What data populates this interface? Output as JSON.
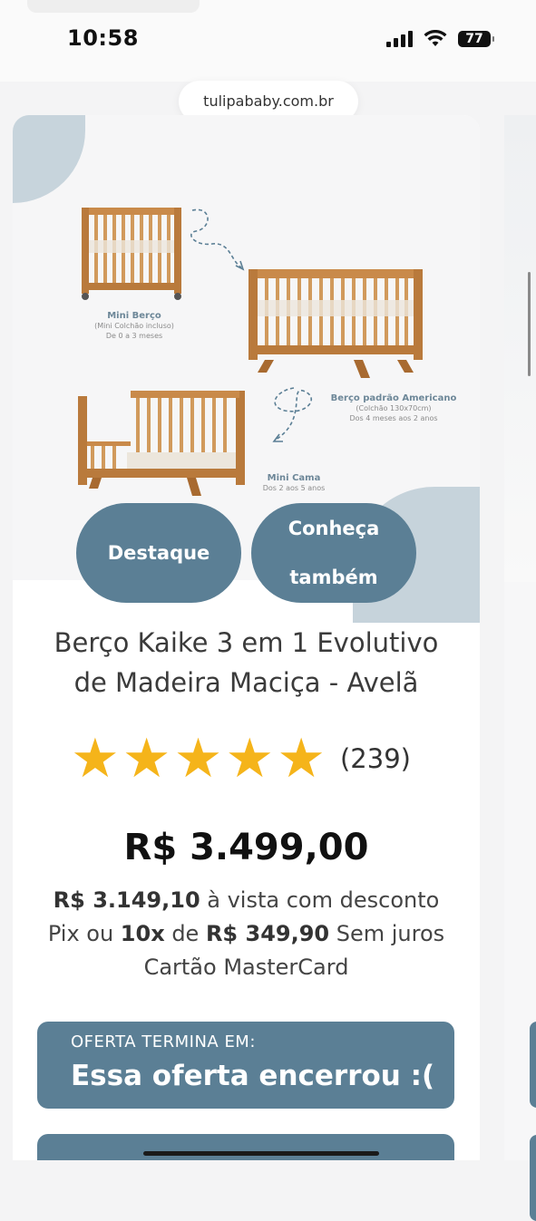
{
  "status_bar": {
    "time": "10:58",
    "battery": "77"
  },
  "browser": {
    "url": "tulipababy.com.br"
  },
  "product_image": {
    "captions": [
      {
        "title": "Mini Berço",
        "lines": [
          "(Mini Colchão incluso)",
          "De 0 a 3 meses"
        ]
      },
      {
        "title": "Berço padrão Americano",
        "lines": [
          "(Colchão 130x70cm)",
          "Dos 4 meses aos 2 anos"
        ]
      },
      {
        "title": "Mini Cama",
        "lines": [
          "Dos 2 aos 5 anos"
        ]
      }
    ],
    "badges": {
      "destaque": "Destaque",
      "conheca_line1": "Conheça",
      "conheca_line2": "também"
    }
  },
  "product": {
    "title_line1": "Berço Kaike 3 em 1 Evolutivo",
    "title_line2": "de Madeira Maciça - Avelã",
    "rating_stars": 5,
    "rating_count": "(239)",
    "price": "R$ 3.499,00",
    "cash_price": "R$ 3.149,10",
    "cash_text": " à vista com desconto",
    "pix_text": "Pix ou ",
    "installments": "10x",
    "installments_of": " de ",
    "installment_value": "R$ 349,90",
    "installment_suffix": " Sem juros",
    "card_text": "Cartão MasterCard"
  },
  "offer": {
    "label": "OFERTA TERMINA EM:",
    "status": "Essa oferta encerrou :("
  },
  "colors": {
    "accent": "#5b7f95",
    "star": "#f5b41a",
    "wood": "#c98a4a"
  },
  "icons": [
    "signal-icon",
    "wifi-icon",
    "battery-icon",
    "star-icon"
  ]
}
